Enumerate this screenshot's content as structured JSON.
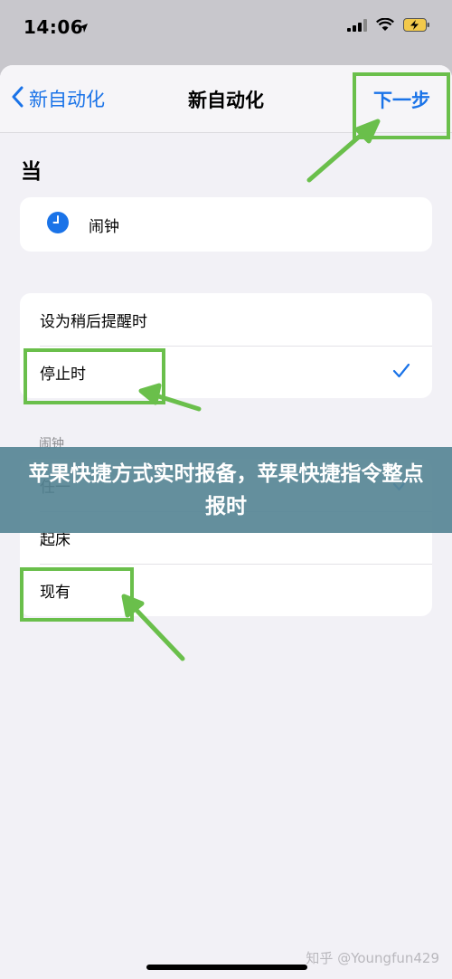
{
  "status_bar": {
    "time": "14:06"
  },
  "nav": {
    "back_label": "新自动化",
    "title": "新自动化",
    "next_label": "下一步"
  },
  "section": {
    "title": "当"
  },
  "trigger": {
    "label": "闹钟"
  },
  "options": [
    {
      "label": "设为稍后提醒时",
      "checked": false
    },
    {
      "label": "停止时",
      "checked": true
    }
  ],
  "alarm_group": {
    "header": "闹钟",
    "items": [
      {
        "label": "任一",
        "checked": true
      },
      {
        "label": "起床",
        "checked": false
      },
      {
        "label": "现有",
        "checked": false
      }
    ]
  },
  "banner": {
    "text": "苹果快捷方式实时报备，苹果快捷指令整点报时"
  },
  "watermark": {
    "text": "知乎 @Youngfun429"
  },
  "colors": {
    "accent": "#1a73e8",
    "annotation": "#6abf4b",
    "banner": "#588696"
  }
}
